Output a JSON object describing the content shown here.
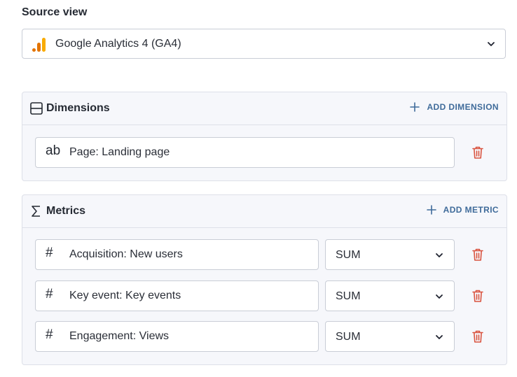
{
  "source": {
    "label": "Source view",
    "selected": "Google Analytics 4 (GA4)",
    "icon": "google-analytics-icon"
  },
  "dimensions": {
    "title": "Dimensions",
    "add_label": "ADD DIMENSION",
    "items": [
      {
        "type_glyph": "ab",
        "label": "Page: Landing page"
      }
    ]
  },
  "metrics": {
    "title": "Metrics",
    "add_label": "ADD METRIC",
    "items": [
      {
        "type_glyph": "#",
        "label": "Acquisition: New users",
        "aggregation": "SUM"
      },
      {
        "type_glyph": "#",
        "label": "Key event: Key events",
        "aggregation": "SUM"
      },
      {
        "type_glyph": "#",
        "label": "Engagement: Views",
        "aggregation": "SUM"
      }
    ]
  },
  "colors": {
    "accent": "#3f6b9a",
    "delete": "#d9533f",
    "ga_orange": "#f9ab00",
    "ga_dark_orange": "#e37400"
  }
}
